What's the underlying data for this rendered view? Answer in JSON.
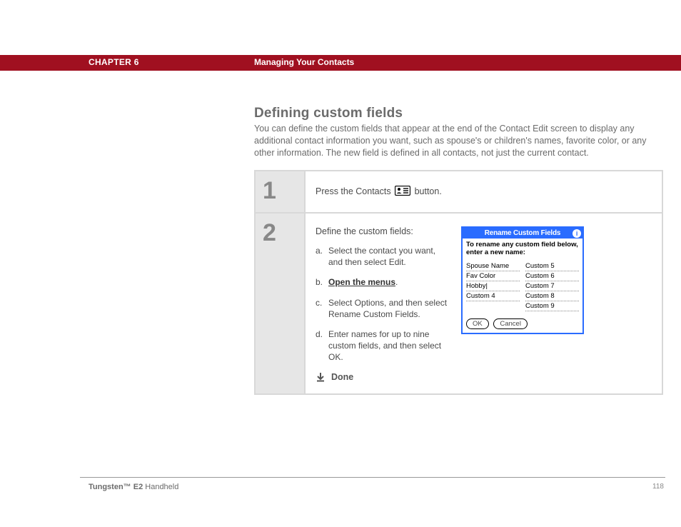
{
  "header": {
    "chapter": "CHAPTER 6",
    "title": "Managing Your Contacts"
  },
  "heading": "Defining custom fields",
  "intro": "You can define the custom fields that appear at the end of the Contact Edit screen to display any additional contact information you want, such as spouse's or children's names, favorite color, or any other information. The new field is defined in all contacts, not just the current contact.",
  "steps": {
    "step1": {
      "num": "1",
      "text_before": "Press the Contacts ",
      "text_after": " button."
    },
    "step2": {
      "num": "2",
      "lead": "Define the custom fields:",
      "a_letter": "a.",
      "a_text": "Select the contact you want, and then select Edit.",
      "b_letter": "b.",
      "b_text": "Open the menus",
      "b_after": ".",
      "c_letter": "c.",
      "c_text": "Select Options, and then select Rename Custom Fields.",
      "d_letter": "d.",
      "d_text": "Enter names for up to nine custom fields, and then select OK.",
      "done": "Done"
    }
  },
  "dialog": {
    "title": "Rename Custom Fields",
    "info": "i",
    "instr": "To rename any custom field below, enter a new name:",
    "left": [
      "Spouse Name",
      "Fav Color",
      "Hobby|",
      "Custom 4",
      ""
    ],
    "right": [
      "Custom 5",
      "Custom 6",
      "Custom 7",
      "Custom 8",
      "Custom 9"
    ],
    "ok": "OK",
    "cancel": "Cancel"
  },
  "footer": {
    "product_bold": "Tungsten™ E2",
    "product_rest": " Handheld",
    "page": "118"
  }
}
